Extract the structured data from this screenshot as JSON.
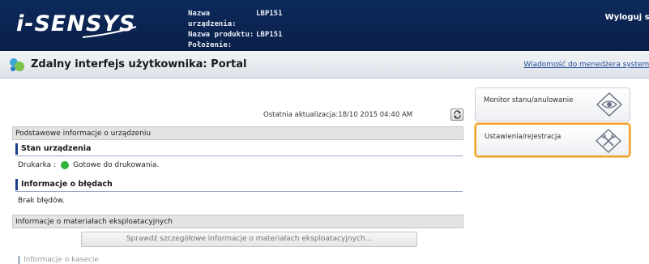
{
  "header": {
    "logo": "i-SENSYS",
    "device_name_label": "Nazwa urządzenia:",
    "device_name": "LBP151",
    "product_name_label": "Nazwa produktu:",
    "product_name": "LBP151",
    "location_label": "Położenie:",
    "location": "",
    "logout_label": "Wyloguj si"
  },
  "titlebar": {
    "title": "Zdalny interfejs użytkownika: Portal",
    "link": "Wiadomość do menedżera systemu"
  },
  "main": {
    "last_update": "Ostatnia aktualizacja:18/10 2015 04:40 AM",
    "refresh_icon": "refresh-icon",
    "basic_info_header": "Podstawowe informacje o urządzeniu",
    "device_status_heading": "Stan urządzenia",
    "printer_label": "Drukarka :",
    "printer_status": "Gotowe do drukowania.",
    "printer_status_color": "#2db43a",
    "error_info_heading": "Informacje o błędach",
    "error_text": "Brak błędów.",
    "consumables_header": "Informacje o materiałach eksploatacyjnych",
    "consumables_button": "Sprawdź szczegółowe informacje o materiałach eksploatacyjnych...",
    "cassette_heading": "Informacje o kasecie"
  },
  "menu": {
    "items": [
      {
        "label": "Monitor stanu/anulowanie",
        "icon": "eye-diamond-icon"
      },
      {
        "label": "Ustawienia/rejestracja",
        "icon": "settings-diamond-icon",
        "highlight_color": "#f0a028"
      }
    ]
  }
}
